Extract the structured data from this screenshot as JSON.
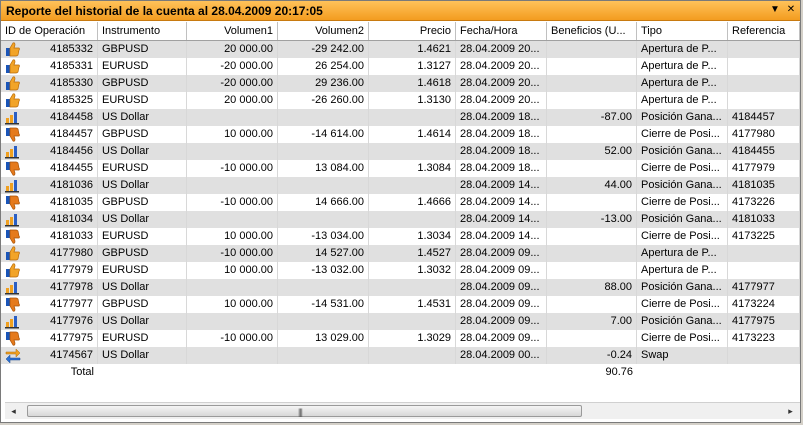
{
  "window": {
    "title": "Reporte del historial de la cuenta al 28.04.2009 20:17:05"
  },
  "columns": [
    "ID de Operación",
    "Instrumento",
    "Volumen1",
    "Volumen2",
    "Precio",
    "Fecha/Hora",
    "Beneficios (U...",
    "Tipo",
    "Referencia"
  ],
  "rows": [
    {
      "icon": "thumbs-up",
      "id": "4185332",
      "inst": "GBPUSD",
      "v1": "20 000.00",
      "v2": "-29 242.00",
      "price": "1.4621",
      "dt": "28.04.2009 20...",
      "profit": "",
      "type": "Apertura de P...",
      "ref": ""
    },
    {
      "icon": "thumbs-up",
      "id": "4185331",
      "inst": "EURUSD",
      "v1": "-20 000.00",
      "v2": "26 254.00",
      "price": "1.3127",
      "dt": "28.04.2009 20...",
      "profit": "",
      "type": "Apertura de P...",
      "ref": ""
    },
    {
      "icon": "thumbs-up",
      "id": "4185330",
      "inst": "GBPUSD",
      "v1": "-20 000.00",
      "v2": "29 236.00",
      "price": "1.4618",
      "dt": "28.04.2009 20...",
      "profit": "",
      "type": "Apertura de P...",
      "ref": ""
    },
    {
      "icon": "thumbs-up",
      "id": "4185325",
      "inst": "EURUSD",
      "v1": "20 000.00",
      "v2": "-26 260.00",
      "price": "1.3130",
      "dt": "28.04.2009 20...",
      "profit": "",
      "type": "Apertura de P...",
      "ref": ""
    },
    {
      "icon": "gain",
      "id": "4184458",
      "inst": "US Dollar",
      "v1": "",
      "v2": "",
      "price": "",
      "dt": "28.04.2009 18...",
      "profit": "-87.00",
      "type": "Posición Gana...",
      "ref": "4184457"
    },
    {
      "icon": "thumbs-down",
      "id": "4184457",
      "inst": "GBPUSD",
      "v1": "10 000.00",
      "v2": "-14 614.00",
      "price": "1.4614",
      "dt": "28.04.2009 18...",
      "profit": "",
      "type": "Cierre de Posi...",
      "ref": "4177980"
    },
    {
      "icon": "gain",
      "id": "4184456",
      "inst": "US Dollar",
      "v1": "",
      "v2": "",
      "price": "",
      "dt": "28.04.2009 18...",
      "profit": "52.00",
      "type": "Posición Gana...",
      "ref": "4184455"
    },
    {
      "icon": "thumbs-down",
      "id": "4184455",
      "inst": "EURUSD",
      "v1": "-10 000.00",
      "v2": "13 084.00",
      "price": "1.3084",
      "dt": "28.04.2009 18...",
      "profit": "",
      "type": "Cierre de Posi...",
      "ref": "4177979"
    },
    {
      "icon": "gain",
      "id": "4181036",
      "inst": "US Dollar",
      "v1": "",
      "v2": "",
      "price": "",
      "dt": "28.04.2009 14...",
      "profit": "44.00",
      "type": "Posición Gana...",
      "ref": "4181035"
    },
    {
      "icon": "thumbs-down",
      "id": "4181035",
      "inst": "GBPUSD",
      "v1": "-10 000.00",
      "v2": "14 666.00",
      "price": "1.4666",
      "dt": "28.04.2009 14...",
      "profit": "",
      "type": "Cierre de Posi...",
      "ref": "4173226"
    },
    {
      "icon": "gain",
      "id": "4181034",
      "inst": "US Dollar",
      "v1": "",
      "v2": "",
      "price": "",
      "dt": "28.04.2009 14...",
      "profit": "-13.00",
      "type": "Posición Gana...",
      "ref": "4181033"
    },
    {
      "icon": "thumbs-down",
      "id": "4181033",
      "inst": "EURUSD",
      "v1": "10 000.00",
      "v2": "-13 034.00",
      "price": "1.3034",
      "dt": "28.04.2009 14...",
      "profit": "",
      "type": "Cierre de Posi...",
      "ref": "4173225"
    },
    {
      "icon": "thumbs-up",
      "id": "4177980",
      "inst": "GBPUSD",
      "v1": "-10 000.00",
      "v2": "14 527.00",
      "price": "1.4527",
      "dt": "28.04.2009 09...",
      "profit": "",
      "type": "Apertura de P...",
      "ref": ""
    },
    {
      "icon": "thumbs-up",
      "id": "4177979",
      "inst": "EURUSD",
      "v1": "10 000.00",
      "v2": "-13 032.00",
      "price": "1.3032",
      "dt": "28.04.2009 09...",
      "profit": "",
      "type": "Apertura de P...",
      "ref": ""
    },
    {
      "icon": "gain",
      "id": "4177978",
      "inst": "US Dollar",
      "v1": "",
      "v2": "",
      "price": "",
      "dt": "28.04.2009 09...",
      "profit": "88.00",
      "type": "Posición Gana...",
      "ref": "4177977"
    },
    {
      "icon": "thumbs-down",
      "id": "4177977",
      "inst": "GBPUSD",
      "v1": "10 000.00",
      "v2": "-14 531.00",
      "price": "1.4531",
      "dt": "28.04.2009 09...",
      "profit": "",
      "type": "Cierre de Posi...",
      "ref": "4173224"
    },
    {
      "icon": "gain",
      "id": "4177976",
      "inst": "US Dollar",
      "v1": "",
      "v2": "",
      "price": "",
      "dt": "28.04.2009 09...",
      "profit": "7.00",
      "type": "Posición Gana...",
      "ref": "4177975"
    },
    {
      "icon": "thumbs-down",
      "id": "4177975",
      "inst": "EURUSD",
      "v1": "-10 000.00",
      "v2": "13 029.00",
      "price": "1.3029",
      "dt": "28.04.2009 09...",
      "profit": "",
      "type": "Cierre de Posi...",
      "ref": "4173223"
    },
    {
      "icon": "swap",
      "id": "4174567",
      "inst": "US Dollar",
      "v1": "",
      "v2": "",
      "price": "",
      "dt": "28.04.2009 00...",
      "profit": "-0.24",
      "type": "Swap",
      "ref": ""
    }
  ],
  "total": {
    "label": "Total",
    "profit": "90.76"
  },
  "scrollbar": {
    "grip": "|||"
  },
  "icons": {
    "close": "▼",
    "close2": "✕",
    "left": "◂",
    "right": "▸"
  },
  "colors": {
    "title_bg": "#f39c1f",
    "row_alt": "#e0e0e0",
    "thumb_up": "#f0a020",
    "thumb_down": "#e07818",
    "gain_bar": "#3060c0"
  }
}
